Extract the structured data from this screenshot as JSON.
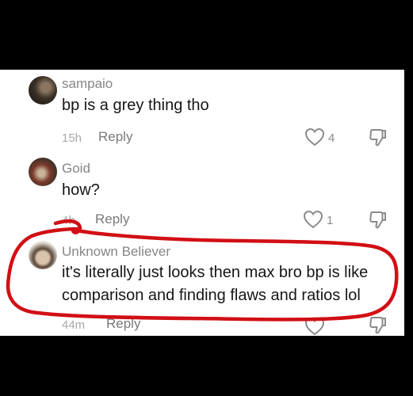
{
  "comments": [
    {
      "username": "sampaio",
      "text": "bp is a grey thing tho",
      "time": "15h",
      "reply": "Reply",
      "likes": "4"
    },
    {
      "username": "Goid",
      "text": "how?",
      "time": "4h",
      "reply": "Reply",
      "likes": "1"
    },
    {
      "username": "Unknown Believer",
      "text_line1": "it's literally just looks then max bro bp is like",
      "text_line2": "comparison and finding flaws and ratios lol",
      "time": "44m",
      "reply": "Reply"
    }
  ],
  "annotation": {
    "color": "#d10f14"
  }
}
